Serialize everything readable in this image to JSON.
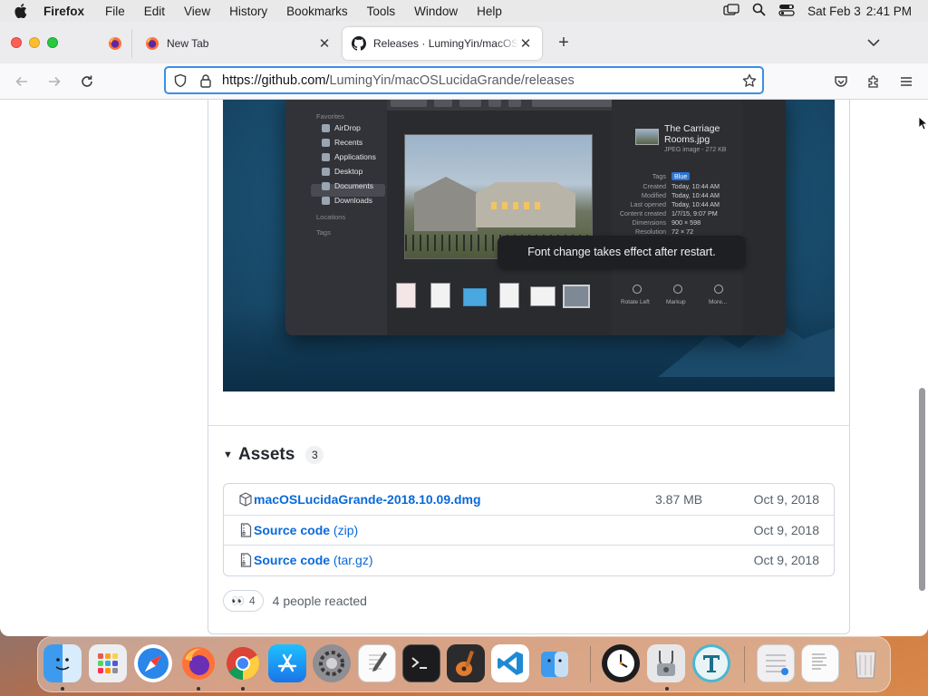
{
  "menubar": {
    "apple_icon": "apple-logo",
    "app_name": "Firefox",
    "items": [
      "File",
      "Edit",
      "View",
      "History",
      "Bookmarks",
      "Tools",
      "Window",
      "Help"
    ],
    "status_icons": [
      "screen-mirroring-icon",
      "spotlight-search-icon",
      "control-center-icon"
    ],
    "date": "Sat Feb 3",
    "time": "2:41 PM"
  },
  "browser": {
    "tabs": [
      {
        "title": "New Tab",
        "favicon": "firefox-icon"
      },
      {
        "title": "Releases · LumingYin/macOSLucidaGrande",
        "favicon": "github-icon",
        "active": true
      }
    ],
    "url_host": "https://github.com/",
    "url_path": "LumingYin/macOSLucidaGrande/releases"
  },
  "finder_preview": {
    "sidebar_favorites_label": "Favorites",
    "sidebar_items": [
      "AirDrop",
      "Recents",
      "Applications",
      "Desktop",
      "Documents",
      "Downloads"
    ],
    "sidebar_locations_label": "Locations",
    "sidebar_tags_label": "Tags",
    "file_name": "The Carriage Rooms.jpg",
    "file_meta": "JPEG image - 272 KB",
    "info_rows": [
      {
        "key": "Tags",
        "value": "Blue"
      },
      {
        "key": "Created",
        "value": "Today, 10:44 AM"
      },
      {
        "key": "Modified",
        "value": "Today, 10:44 AM"
      },
      {
        "key": "Last opened",
        "value": "Today, 10:44 AM"
      },
      {
        "key": "Content created",
        "value": "1/7/15, 9:07 PM"
      },
      {
        "key": "Dimensions",
        "value": "900 × 598"
      },
      {
        "key": "Resolution",
        "value": "72 × 72"
      }
    ],
    "actions": [
      "Rotate Left",
      "Markup",
      "More..."
    ]
  },
  "toast": "Font change takes effect after restart.",
  "assets": {
    "title": "Assets",
    "count": "3",
    "rows": [
      {
        "name": "macOSLucidaGrande-2018.10.09.dmg",
        "ext": "",
        "size": "3.87 MB",
        "date": "Oct 9, 2018",
        "icon": "package-icon"
      },
      {
        "name": "Source code",
        "ext": " (zip)",
        "size": "",
        "date": "Oct 9, 2018",
        "icon": "file-zip-icon"
      },
      {
        "name": "Source code",
        "ext": " (tar.gz)",
        "size": "",
        "date": "Oct 9, 2018",
        "icon": "file-zip-icon"
      }
    ]
  },
  "reactions": {
    "emoji": "👀",
    "count": "4",
    "summary": "4 people reacted"
  },
  "dock": {
    "apps": [
      "Finder",
      "Launchpad",
      "Safari",
      "Firefox",
      "Google Chrome",
      "App Store",
      "System Preferences",
      "TextEdit",
      "Terminal",
      "GarageBand",
      "Visual Studio Code",
      "Migration Assistant",
      "Clock",
      "Disk Utility",
      "Typora"
    ],
    "extras": [
      "Downloads",
      "Documents",
      "Trash"
    ]
  },
  "colors": {
    "link": "#0969da",
    "url_focus": "#3c8ee5",
    "toast_bg": "#1e1f22"
  }
}
